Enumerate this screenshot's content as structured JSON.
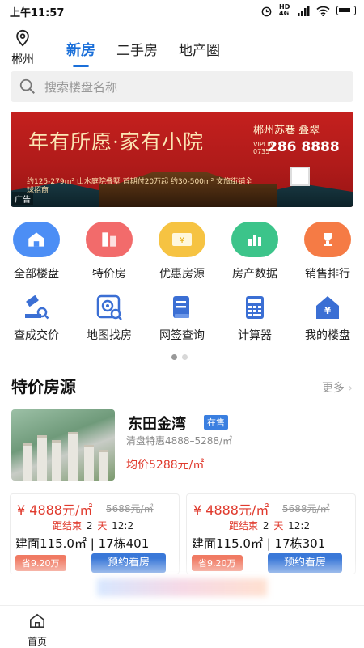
{
  "status_bar": {
    "time": "上午11:57",
    "network": "HD 4G"
  },
  "header": {
    "city": "郴州",
    "tabs": [
      {
        "label": "新房",
        "active": true
      },
      {
        "label": "二手房",
        "active": false
      },
      {
        "label": "地产圈",
        "active": false
      }
    ]
  },
  "search": {
    "placeholder": "搜索楼盘名称"
  },
  "banner": {
    "slogan": "年有所愿·家有小院",
    "brand": "郴州苏巷 叠翠",
    "vipline_label": "VIPLINE",
    "area_code": "0735",
    "phone": "286 8888",
    "sub_text": "约125-279m² 山水庭院叠墅 首期付20万起 约30-500m² 文旅街铺全球招商",
    "ad_tag": "广告"
  },
  "quick_menu": [
    {
      "label": "全部楼盘",
      "icon": "home-icon",
      "color": "#4c8ef5"
    },
    {
      "label": "特价房",
      "icon": "building-icon",
      "color": "#f26b6b"
    },
    {
      "label": "优惠房源",
      "icon": "coupon-icon",
      "color": "#f6c342"
    },
    {
      "label": "房产数据",
      "icon": "bar-chart-icon",
      "color": "#3cc48a"
    },
    {
      "label": "销售排行",
      "icon": "trophy-icon",
      "color": "#f57b45"
    },
    {
      "label": "查成交价",
      "icon": "gavel-icon",
      "color": "#3b6fd4"
    },
    {
      "label": "地图找房",
      "icon": "map-search-icon",
      "color": "#3b6fd4"
    },
    {
      "label": "网签查询",
      "icon": "contract-icon",
      "color": "#3b6fd4"
    },
    {
      "label": "计算器",
      "icon": "calculator-icon",
      "color": "#3b6fd4"
    },
    {
      "label": "我的楼盘",
      "icon": "my-home-icon",
      "color": "#3b6fd4"
    }
  ],
  "special": {
    "title": "特价房源",
    "more": "更多",
    "project": {
      "name": "东田金湾",
      "status": "在售",
      "desc": "清盘特惠4888–5288/㎡",
      "avg_price": "均价5288元/㎡"
    },
    "cards": [
      {
        "price": "¥ 4888元/㎡",
        "orig": "5688元/㎡",
        "cd_label": "距结束",
        "cd_days": "2",
        "cd_unit": "天",
        "cd_time": "12:2",
        "spec": "建面115.0㎡ | 17栋401",
        "save": "省9.20万",
        "book": "预约看房"
      },
      {
        "price": "¥ 4888元/㎡",
        "orig": "5688元/㎡",
        "cd_label": "距结束",
        "cd_days": "2",
        "cd_unit": "天",
        "cd_time": "12:2",
        "spec": "建面115.0㎡ | 17栋301",
        "save": "省9.20万",
        "book": "预约看房"
      }
    ]
  },
  "bottom_nav": {
    "home": "首页"
  }
}
